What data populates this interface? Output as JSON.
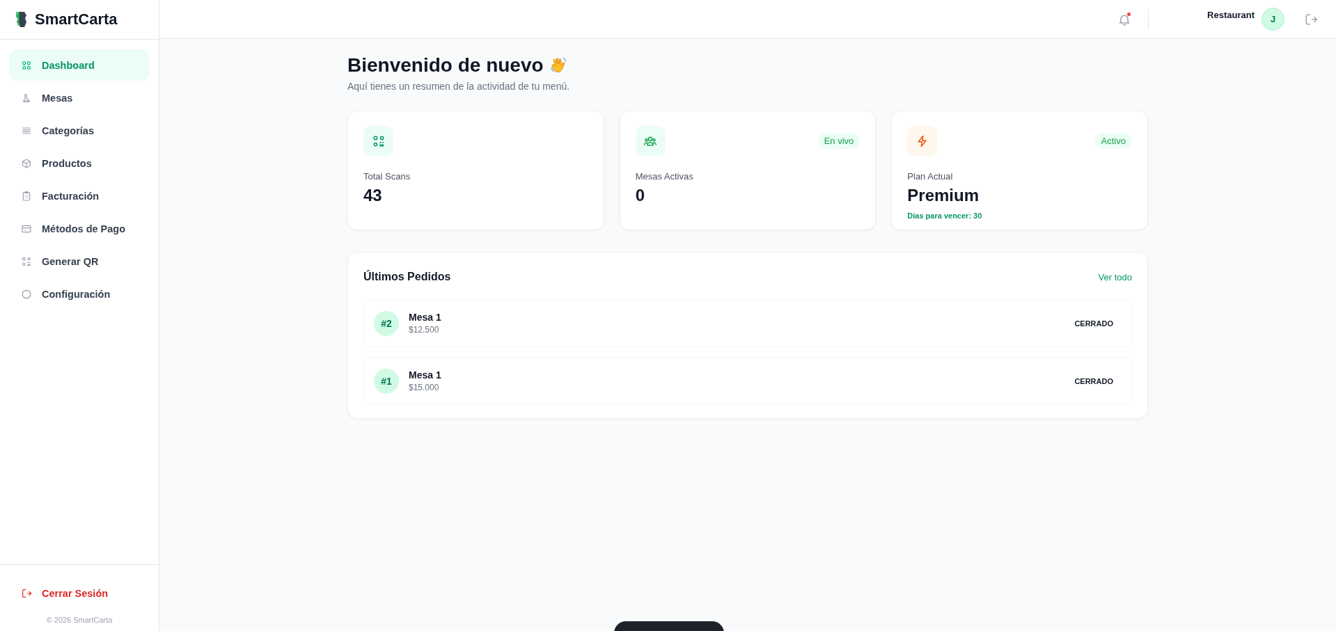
{
  "sidebar": {
    "brand": "SmartCarta",
    "items": [
      {
        "label": "Dashboard",
        "selected": true
      },
      {
        "label": "Mesas",
        "selected": false
      },
      {
        "label": "Categorías",
        "selected": false
      },
      {
        "label": "Productos",
        "selected": false
      },
      {
        "label": "Facturación",
        "selected": false
      },
      {
        "label": "Métodos de Pago",
        "selected": false
      },
      {
        "label": "Generar QR",
        "selected": false
      },
      {
        "label": "Configuración",
        "selected": false
      }
    ],
    "logout": "Cerrar Sesión",
    "footer": "© 2026 SmartCarta"
  },
  "header": {
    "notifications": {
      "unread": true
    },
    "user": {
      "name": "Restaurant",
      "initial": "J"
    }
  },
  "welcome": {
    "title": "Bienvenido de nuevo",
    "subtitle": "Aquí tienes un resumen de la actividad de tu menú."
  },
  "stats": [
    {
      "label": "Total Scans",
      "value": "43"
    },
    {
      "label": "Mesas Activas",
      "value": "0",
      "badge": "En vivo"
    },
    {
      "label": "Plan Actual",
      "value": "Premium",
      "badge": "Activo",
      "note": "Días para vencer: 30"
    }
  ],
  "orders": {
    "title": "Últimos Pedidos",
    "link": "Ver todo",
    "rows": [
      {
        "number": "#2",
        "table": "Mesa 1",
        "total": "$12.500",
        "status": "CERRADO"
      },
      {
        "number": "#1",
        "table": "Mesa 1",
        "total": "$15.000",
        "status": "CERRADO"
      }
    ]
  }
}
